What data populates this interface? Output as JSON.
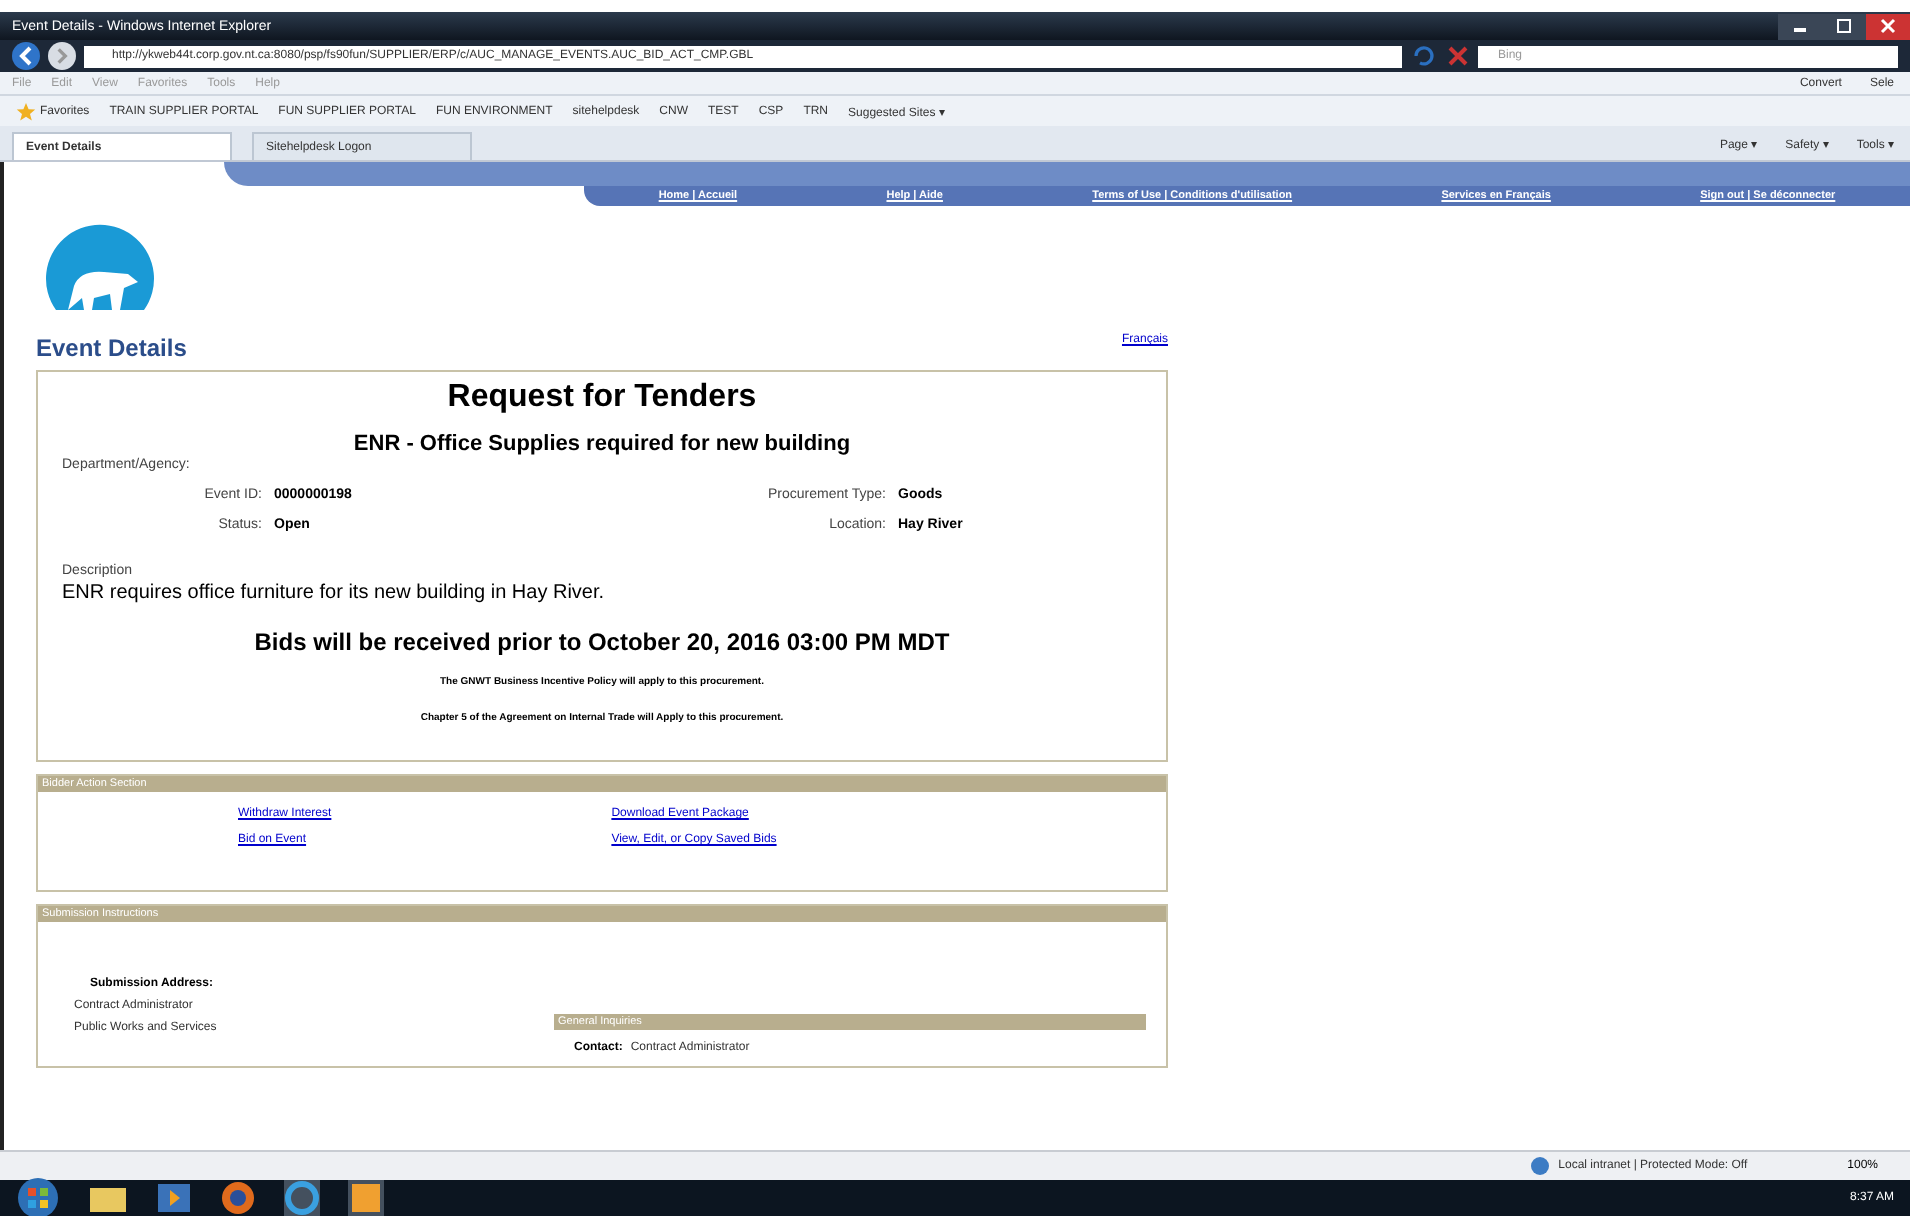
{
  "window": {
    "title": "Event Details - Windows Internet Explorer"
  },
  "address_bar": {
    "url": "http://ykweb44t.corp.gov.nt.ca:8080/psp/fs90fun/SUPPLIER/ERP/c/AUC_MANAGE_EVENTS.AUC_BID_ACT_CMP.GBL",
    "search_placeholder": "Bing"
  },
  "menu": [
    "File",
    "Edit",
    "View",
    "Favorites",
    "Tools",
    "Help"
  ],
  "command_right": [
    "Convert",
    "Sele"
  ],
  "favorites_bar": {
    "label": "Favorites",
    "links": [
      "TRAIN SUPPLIER PORTAL",
      "FUN SUPPLIER PORTAL",
      "FUN ENVIRONMENT",
      "sitehelpdesk",
      "CNW",
      "TEST",
      "CSP",
      "TRN",
      "Suggested Sites ▾"
    ]
  },
  "tabs": [
    {
      "label": "Event Details",
      "selected": true
    },
    {
      "label": "Sitehelpdesk Logon",
      "selected": false
    }
  ],
  "toolbar": [
    "Page ▾",
    "Safety ▾",
    "Tools ▾"
  ],
  "site_nav": [
    "Home | Accueil",
    "Help | Aide",
    "Terms of Use | Conditions d'utilisation",
    "Services en Français",
    "Sign out | Se déconnecter"
  ],
  "page": {
    "heading": "Event Details",
    "language_link": "Français",
    "event": {
      "title": "Request for Tenders",
      "subtitle": "ENR - Office Supplies required for new building",
      "department_label": "Department/Agency:",
      "fields_left": [
        {
          "label": "Event ID:",
          "value": "0000000198"
        },
        {
          "label": "Status:",
          "value": "Open"
        }
      ],
      "fields_right": [
        {
          "label": "Procurement Type:",
          "value": "Goods"
        },
        {
          "label": "Location:",
          "value": "Hay River"
        }
      ],
      "description_label": "Description",
      "description": "ENR requires office furniture for its new building in Hay River.",
      "deadline": "Bids will be received prior to October 20, 2016 03:00 PM MDT",
      "notes": [
        "The GNWT Business Incentive Policy will apply to this procurement.",
        "Chapter 5 of the Agreement on Internal Trade will Apply to this procurement."
      ]
    },
    "bidder_section": {
      "title": "Bidder Action Section",
      "links_left": [
        "Withdraw Interest",
        "Bid on Event"
      ],
      "links_right": [
        "Download Event Package",
        "View, Edit, or Copy Saved Bids"
      ]
    },
    "submission_section": {
      "title": "Submission Instructions",
      "address_label": "Submission Address:",
      "address_lines": [
        "Contract Administrator",
        "Public Works and Services"
      ],
      "inquiries_title": "General Inquiries",
      "contact_label": "Contact:",
      "contact_value": "Contract Administrator"
    }
  },
  "status_bar": {
    "zone": "Local intranet | Protected Mode: Off",
    "zoom": "100%"
  },
  "taskbar": {
    "time": "8:37 AM"
  }
}
